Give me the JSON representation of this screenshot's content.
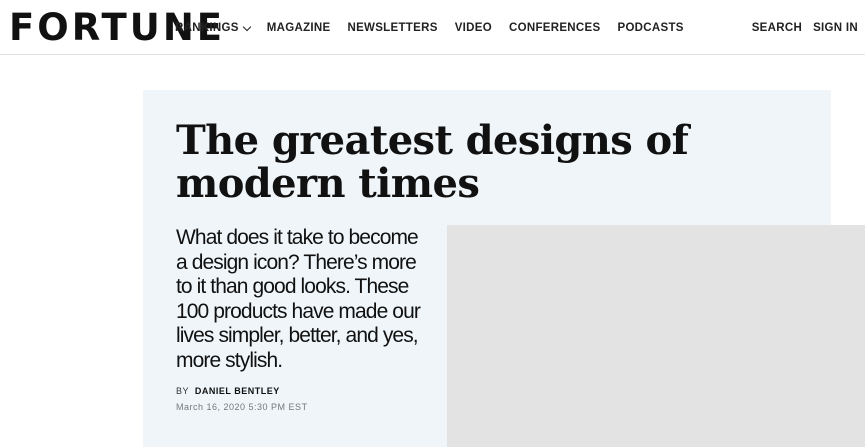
{
  "header": {
    "logo": "FORTUNE",
    "nav": [
      {
        "label": "RANKINGS",
        "has_dropdown": true
      },
      {
        "label": "MAGAZINE"
      },
      {
        "label": "NEWSLETTERS"
      },
      {
        "label": "VIDEO"
      },
      {
        "label": "CONFERENCES"
      },
      {
        "label": "PODCASTS"
      }
    ],
    "search_label": "SEARCH",
    "signin_label": "SIGN IN"
  },
  "article": {
    "headline": "The greatest designs of modern times",
    "dek": "What does it take to become a design icon? There’s more to it than good looks. These 100 products have made our lives simpler, better, and yes, more stylish.",
    "byline_prefix": "BY",
    "author": "DANIEL BENTLEY",
    "date": "March 16, 2020 5:30 PM EST"
  },
  "colors": {
    "hero_background": "#eff5f9",
    "image_placeholder": "#e3e3e3",
    "text": "#111111",
    "muted_text": "#777777"
  },
  "icons": {
    "dropdown": "chevron-down-icon"
  }
}
